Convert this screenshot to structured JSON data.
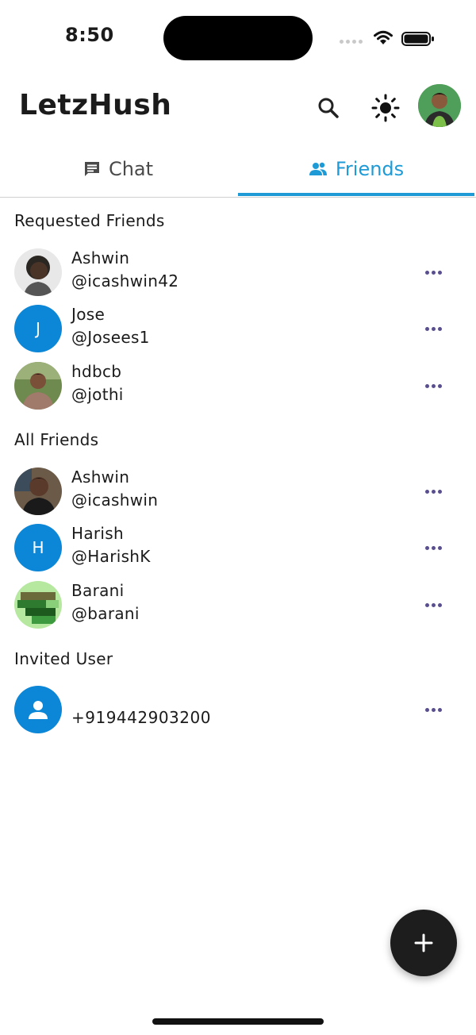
{
  "status_bar": {
    "time": "8:50"
  },
  "app": {
    "title": "LetzHush"
  },
  "tabs": [
    {
      "label": "Chat",
      "icon": "chat-icon"
    },
    {
      "label": "Friends",
      "icon": "friends-icon",
      "active": true
    }
  ],
  "colors": {
    "accent": "#1e9bd7",
    "avatar_blue": "#0c86d6",
    "fab": "#1d1d1d",
    "more_dots": "#5a4f8e"
  },
  "sections": {
    "requested": {
      "title": "Requested Friends",
      "items": [
        {
          "name": "Ashwin",
          "handle": "@icashwin42",
          "avatar": "photo"
        },
        {
          "name": "Jose",
          "handle": "@Josees1",
          "avatar": "letter",
          "initial": "J"
        },
        {
          "name": "hdbcb",
          "handle": "@jothi",
          "avatar": "photo"
        }
      ]
    },
    "all": {
      "title": "All Friends",
      "items": [
        {
          "name": "Ashwin",
          "handle": "@icashwin",
          "avatar": "photo"
        },
        {
          "name": "Harish",
          "handle": "@HarishK",
          "avatar": "letter",
          "initial": "H"
        },
        {
          "name": "Barani",
          "handle": "@barani",
          "avatar": "photo"
        }
      ]
    },
    "invited": {
      "title": "Invited User",
      "items": [
        {
          "phone": "+919442903200",
          "avatar": "person-icon"
        }
      ]
    }
  },
  "fab": {
    "icon": "plus-icon"
  }
}
